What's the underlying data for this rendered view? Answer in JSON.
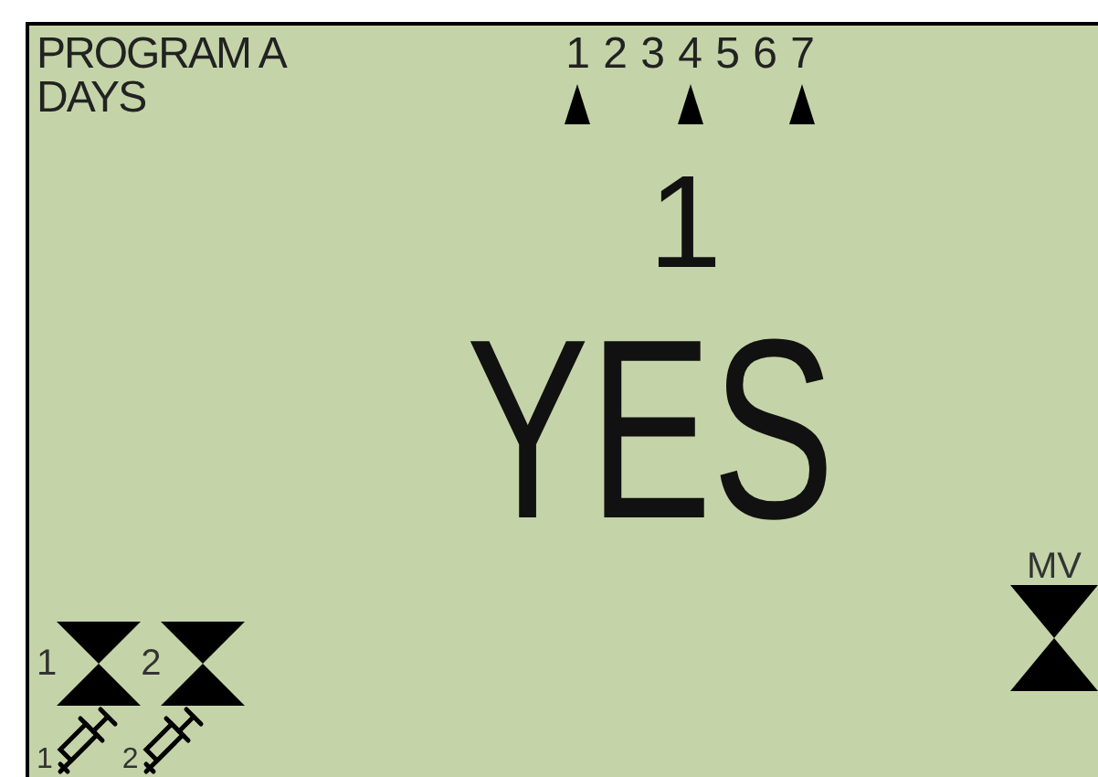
{
  "header": {
    "title": "PROGRAM A",
    "subtitle": "DAYS"
  },
  "days": [
    {
      "label": "1",
      "selected": true
    },
    {
      "label": "2",
      "selected": false
    },
    {
      "label": "3",
      "selected": false
    },
    {
      "label": "4",
      "selected": true
    },
    {
      "label": "5",
      "selected": false
    },
    {
      "label": "6",
      "selected": false
    },
    {
      "label": "7",
      "selected": true
    }
  ],
  "display": {
    "line_1": "1",
    "line_2": "YES"
  },
  "valves": [
    {
      "label": "1"
    },
    {
      "label": "2"
    }
  ],
  "sensors": [
    {
      "label": "1"
    },
    {
      "label": "2"
    }
  ],
  "master_valve": {
    "label": "MV"
  }
}
